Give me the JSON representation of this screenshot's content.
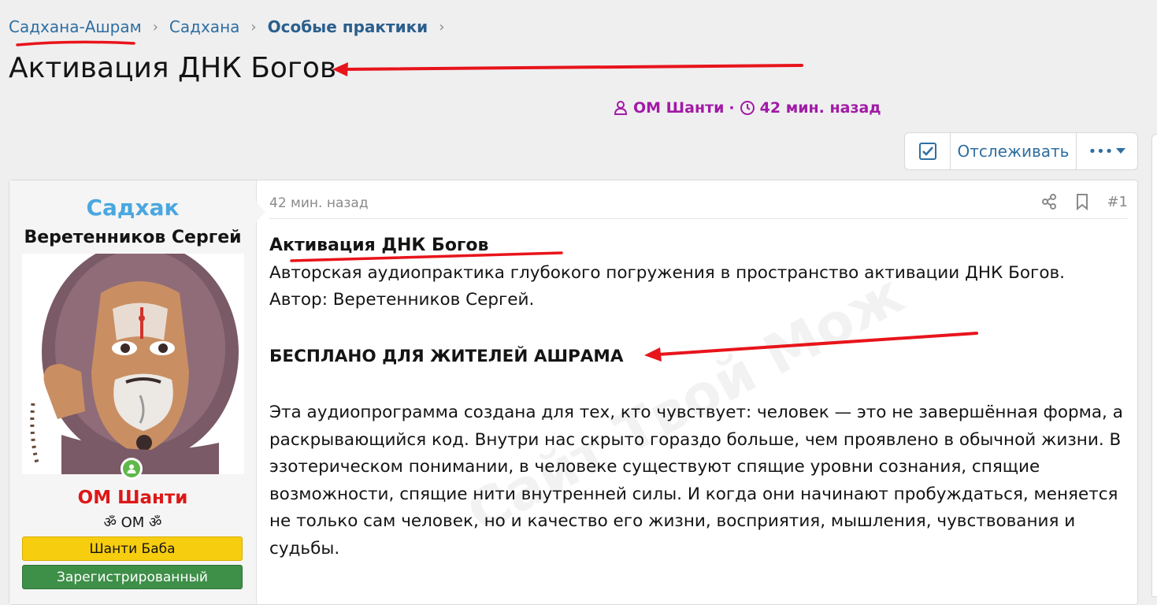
{
  "breadcrumb": [
    {
      "label": "Садхана-Ашрам"
    },
    {
      "label": "Садхана"
    },
    {
      "label": "Особые практики"
    }
  ],
  "thread": {
    "title": "Активация ДНК Богов",
    "author": "ОМ Шанти",
    "time": "42 мин. назад",
    "meta_sep": "·"
  },
  "toolbar": {
    "watch_label": "Отслеживать",
    "more_label": "•••"
  },
  "user": {
    "name": "Садхак",
    "title": "Веретенников Сергей",
    "group": "ОМ Шанти",
    "status": "ॐ ОМ ॐ",
    "banners": [
      "Шанти Баба",
      "Зарегистрированный"
    ]
  },
  "post": {
    "date": "42 мин. назад",
    "number": "#1",
    "heading": "Активация ДНК Богов",
    "intro": "Авторская аудиопрактика глубокого погружения в пространство активации ДНК Богов.",
    "author_line": "Автор: Веретенников Сергей.",
    "free_line": "БЕСПЛАНО ДЛЯ ЖИТЕЛЕЙ АШРАМА",
    "body": "Эта аудиопрограмма создана для тех, кто чувствует: человек — это не завершённая форма, а раскрывающийся код. Внутри нас скрыто гораздо больше, чем проявлено в обычной жизни. В эзотерическом понимании, в человеке существуют спящие уровни сознания, спящие возможности, спящие нити внутренней силы. И когда они начинают пробуждаться, меняется не только сам человек, но и качество его жизни, восприятия, мышления, чувствования и судьбы."
  },
  "watermark": "Сайт Твой Мож",
  "colors": {
    "link": "#2f6ea0",
    "meta": "#a21aa6",
    "username": "#4aa7e0",
    "group": "#dd1717",
    "banner_gold": "#f7cd0f",
    "banner_green": "#3e8f48",
    "annotation": "#e8141b"
  },
  "icons": [
    "chevron-right-icon",
    "user-icon",
    "clock-icon",
    "checkbox-icon",
    "caret-down-icon",
    "share-icon",
    "bookmark-icon"
  ]
}
